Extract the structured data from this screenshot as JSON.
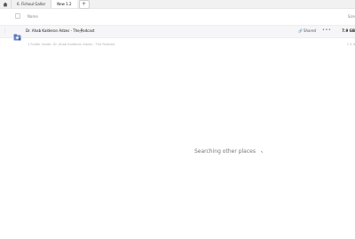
{
  "tabs": [
    {
      "label": "6. Fichoul Gallor"
    },
    {
      "label": "New 1.2",
      "active": true
    }
  ],
  "header": {
    "name_label": "Name",
    "size_label": "Size"
  },
  "file": {
    "name": "Dr. Ahab Kalderon Adzes - The Podcast",
    "shared_label": "Shared",
    "size": "7.9 GB"
  },
  "subrow": {
    "hint": "1 Folder Inside: Dr. Ahab Kalderon Adzes - The Podcast",
    "count": "1 if it"
  },
  "status": {
    "searching_text": "Searching other places"
  }
}
